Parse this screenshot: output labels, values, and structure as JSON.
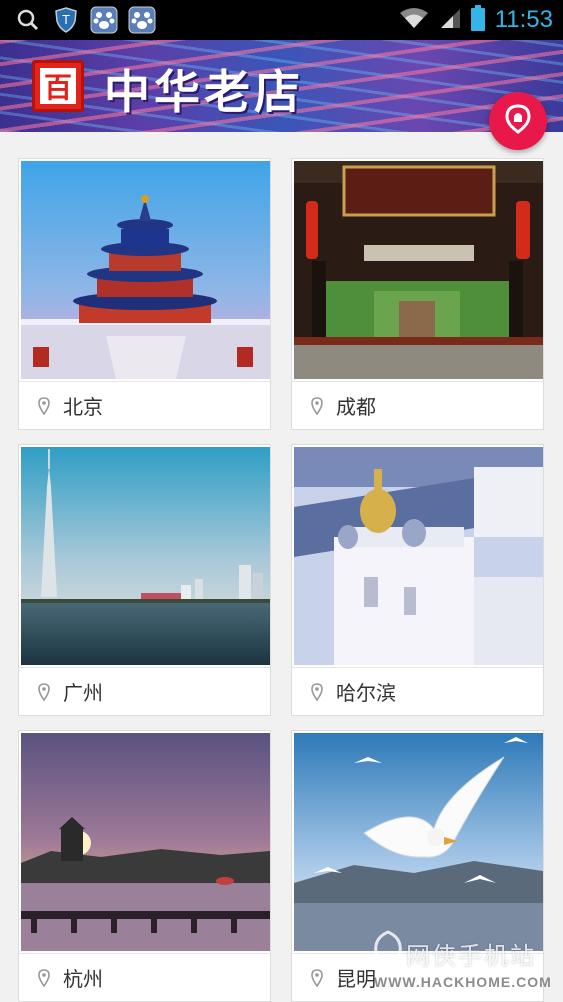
{
  "status_bar": {
    "time": "11:53"
  },
  "banner": {
    "logo_char": "百",
    "title": "中华老店"
  },
  "cities": [
    {
      "name": "北京"
    },
    {
      "name": "成都"
    },
    {
      "name": "广州"
    },
    {
      "name": "哈尔滨"
    },
    {
      "name": "杭州"
    },
    {
      "name": "昆明"
    }
  ],
  "watermark": {
    "cn": "网侠手机站",
    "en": "WWW.HACKHOME.COM"
  },
  "colors": {
    "accent": "#e8194a",
    "status_time": "#33b5e5",
    "logo_red": "#e2231a"
  }
}
